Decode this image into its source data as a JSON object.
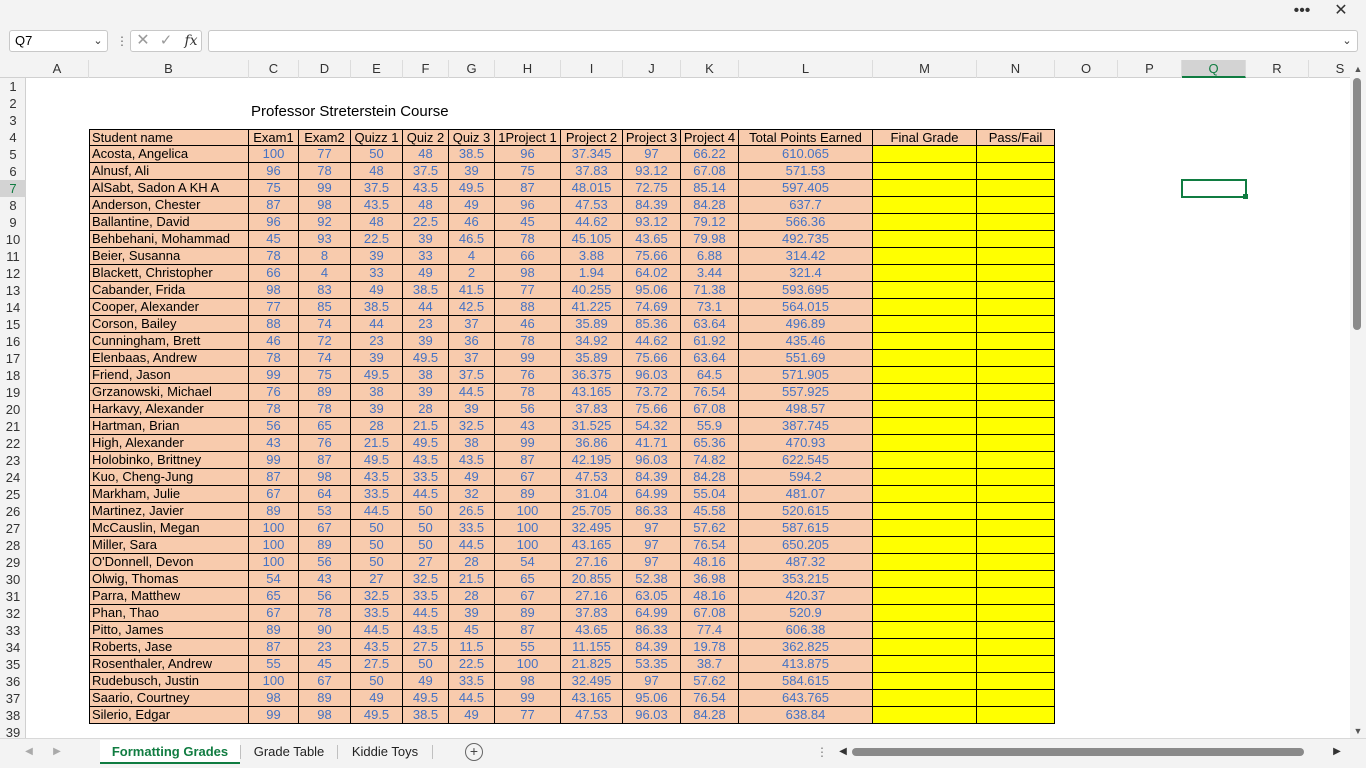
{
  "window": {
    "more_icon": "more-icon",
    "close_icon": "close-icon"
  },
  "formula_bar": {
    "name_box": "Q7",
    "formula_value": "",
    "fx_label": "fx"
  },
  "columns": [
    "A",
    "B",
    "C",
    "D",
    "E",
    "F",
    "G",
    "H",
    "I",
    "J",
    "K",
    "L",
    "M",
    "N",
    "O",
    "P",
    "Q",
    "R",
    "S"
  ],
  "selected_column": "Q",
  "rows": [
    "1",
    "2",
    "3",
    "4",
    "5",
    "6",
    "7",
    "8",
    "9",
    "10",
    "11",
    "12",
    "13",
    "14",
    "15",
    "16",
    "17",
    "18",
    "19",
    "20",
    "21",
    "22",
    "23",
    "24",
    "25",
    "26",
    "27",
    "28",
    "29",
    "30",
    "31",
    "32",
    "33",
    "34",
    "35",
    "36",
    "37",
    "38",
    "39"
  ],
  "selected_row": "7",
  "sheet_title": "Professor Streterstein Course",
  "table_headers": [
    "Student name",
    "Exam1",
    "Exam2",
    "Quizz 1",
    "Quiz 2",
    "Quiz 3",
    "1Project 1",
    "Project 2",
    "Project 3",
    "Project 4",
    "Total Points Earned",
    "Final Grade",
    "Pass/Fail"
  ],
  "students": [
    [
      "Acosta, Angelica",
      "100",
      "77",
      "50",
      "48",
      "38.5",
      "96",
      "37.345",
      "97",
      "66.22",
      "610.065"
    ],
    [
      "Alnusf, Ali",
      "96",
      "78",
      "48",
      "37.5",
      "39",
      "75",
      "37.83",
      "93.12",
      "67.08",
      "571.53"
    ],
    [
      "AlSabt, Sadon A KH A",
      "75",
      "99",
      "37.5",
      "43.5",
      "49.5",
      "87",
      "48.015",
      "72.75",
      "85.14",
      "597.405"
    ],
    [
      "Anderson, Chester",
      "87",
      "98",
      "43.5",
      "48",
      "49",
      "96",
      "47.53",
      "84.39",
      "84.28",
      "637.7"
    ],
    [
      "Ballantine, David",
      "96",
      "92",
      "48",
      "22.5",
      "46",
      "45",
      "44.62",
      "93.12",
      "79.12",
      "566.36"
    ],
    [
      "Behbehani, Mohammad",
      "45",
      "93",
      "22.5",
      "39",
      "46.5",
      "78",
      "45.105",
      "43.65",
      "79.98",
      "492.735"
    ],
    [
      "Beier, Susanna",
      "78",
      "8",
      "39",
      "33",
      "4",
      "66",
      "3.88",
      "75.66",
      "6.88",
      "314.42"
    ],
    [
      "Blackett, Christopher",
      "66",
      "4",
      "33",
      "49",
      "2",
      "98",
      "1.94",
      "64.02",
      "3.44",
      "321.4"
    ],
    [
      "Cabander, Frida",
      "98",
      "83",
      "49",
      "38.5",
      "41.5",
      "77",
      "40.255",
      "95.06",
      "71.38",
      "593.695"
    ],
    [
      "Cooper, Alexander",
      "77",
      "85",
      "38.5",
      "44",
      "42.5",
      "88",
      "41.225",
      "74.69",
      "73.1",
      "564.015"
    ],
    [
      "Corson, Bailey",
      "88",
      "74",
      "44",
      "23",
      "37",
      "46",
      "35.89",
      "85.36",
      "63.64",
      "496.89"
    ],
    [
      "Cunningham, Brett",
      "46",
      "72",
      "23",
      "39",
      "36",
      "78",
      "34.92",
      "44.62",
      "61.92",
      "435.46"
    ],
    [
      "Elenbaas, Andrew",
      "78",
      "74",
      "39",
      "49.5",
      "37",
      "99",
      "35.89",
      "75.66",
      "63.64",
      "551.69"
    ],
    [
      "Friend, Jason",
      "99",
      "75",
      "49.5",
      "38",
      "37.5",
      "76",
      "36.375",
      "96.03",
      "64.5",
      "571.905"
    ],
    [
      "Grzanowski, Michael",
      "76",
      "89",
      "38",
      "39",
      "44.5",
      "78",
      "43.165",
      "73.72",
      "76.54",
      "557.925"
    ],
    [
      "Harkavy, Alexander",
      "78",
      "78",
      "39",
      "28",
      "39",
      "56",
      "37.83",
      "75.66",
      "67.08",
      "498.57"
    ],
    [
      "Hartman, Brian",
      "56",
      "65",
      "28",
      "21.5",
      "32.5",
      "43",
      "31.525",
      "54.32",
      "55.9",
      "387.745"
    ],
    [
      "High, Alexander",
      "43",
      "76",
      "21.5",
      "49.5",
      "38",
      "99",
      "36.86",
      "41.71",
      "65.36",
      "470.93"
    ],
    [
      "Holobinko, Brittney",
      "99",
      "87",
      "49.5",
      "43.5",
      "43.5",
      "87",
      "42.195",
      "96.03",
      "74.82",
      "622.545"
    ],
    [
      "Kuo, Cheng-Jung",
      "87",
      "98",
      "43.5",
      "33.5",
      "49",
      "67",
      "47.53",
      "84.39",
      "84.28",
      "594.2"
    ],
    [
      "Markham, Julie",
      "67",
      "64",
      "33.5",
      "44.5",
      "32",
      "89",
      "31.04",
      "64.99",
      "55.04",
      "481.07"
    ],
    [
      "Martinez, Javier",
      "89",
      "53",
      "44.5",
      "50",
      "26.5",
      "100",
      "25.705",
      "86.33",
      "45.58",
      "520.615"
    ],
    [
      "McCauslin, Megan",
      "100",
      "67",
      "50",
      "50",
      "33.5",
      "100",
      "32.495",
      "97",
      "57.62",
      "587.615"
    ],
    [
      "Miller, Sara",
      "100",
      "89",
      "50",
      "50",
      "44.5",
      "100",
      "43.165",
      "97",
      "76.54",
      "650.205"
    ],
    [
      "O'Donnell, Devon",
      "100",
      "56",
      "50",
      "27",
      "28",
      "54",
      "27.16",
      "97",
      "48.16",
      "487.32"
    ],
    [
      "Olwig, Thomas",
      "54",
      "43",
      "27",
      "32.5",
      "21.5",
      "65",
      "20.855",
      "52.38",
      "36.98",
      "353.215"
    ],
    [
      "Parra, Matthew",
      "65",
      "56",
      "32.5",
      "33.5",
      "28",
      "67",
      "27.16",
      "63.05",
      "48.16",
      "420.37"
    ],
    [
      "Phan, Thao",
      "67",
      "78",
      "33.5",
      "44.5",
      "39",
      "89",
      "37.83",
      "64.99",
      "67.08",
      "520.9"
    ],
    [
      "Pitto, James",
      "89",
      "90",
      "44.5",
      "43.5",
      "45",
      "87",
      "43.65",
      "86.33",
      "77.4",
      "606.38"
    ],
    [
      "Roberts, Jase",
      "87",
      "23",
      "43.5",
      "27.5",
      "11.5",
      "55",
      "11.155",
      "84.39",
      "19.78",
      "362.825"
    ],
    [
      "Rosenthaler, Andrew",
      "55",
      "45",
      "27.5",
      "50",
      "22.5",
      "100",
      "21.825",
      "53.35",
      "38.7",
      "413.875"
    ],
    [
      "Rudebusch, Justin",
      "100",
      "67",
      "50",
      "49",
      "33.5",
      "98",
      "32.495",
      "97",
      "57.62",
      "584.615"
    ],
    [
      "Saario, Courtney",
      "98",
      "89",
      "49",
      "49.5",
      "44.5",
      "99",
      "43.165",
      "95.06",
      "76.54",
      "643.765"
    ],
    [
      "Silerio, Edgar",
      "99",
      "98",
      "49.5",
      "38.5",
      "49",
      "77",
      "47.53",
      "96.03",
      "84.28",
      "638.84"
    ]
  ],
  "sheet_tabs": [
    "Formatting Grades",
    "Grade Table",
    "Kiddie Toys"
  ],
  "active_tab": "Formatting Grades",
  "colors": {
    "header_fill": "#f8cbad",
    "number_text": "#4472c4",
    "grade_fill": "#ffff00",
    "accent": "#107c41"
  }
}
